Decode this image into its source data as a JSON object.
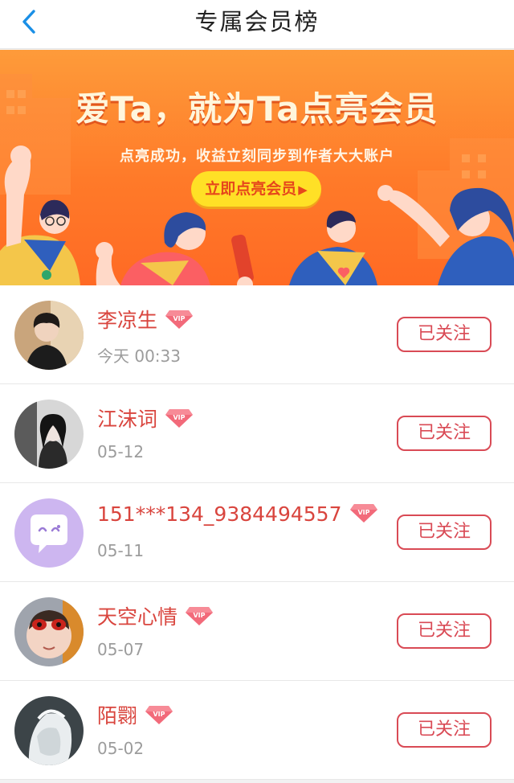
{
  "header": {
    "title": "专属会员榜",
    "back_icon": "chevron-left-icon"
  },
  "banner": {
    "headline": "爱Ta，就为Ta点亮会员",
    "subtitle": "点亮成功，收益立刻同步到作者大大账户",
    "button_label": "立即点亮会员",
    "button_icon": "triangle-right-icon",
    "colors": {
      "bg_top": "#fe9b3a",
      "bg_bottom": "#ff6a24",
      "button": "#ffe026"
    }
  },
  "members": [
    {
      "name": "李凉生",
      "date": "今天 00:33",
      "badge": "VIP",
      "follow_label": "已关注"
    },
    {
      "name": "江沫词",
      "date": "05-12",
      "badge": "VIP",
      "follow_label": "已关注"
    },
    {
      "name": "151***134_9384494557",
      "date": "05-11",
      "badge": "VIP",
      "follow_label": "已关注"
    },
    {
      "name": "天空心情",
      "date": "05-07",
      "badge": "VIP",
      "follow_label": "已关注"
    },
    {
      "name": "陌翾",
      "date": "05-02",
      "badge": "VIP",
      "follow_label": "已关注"
    }
  ],
  "colors": {
    "name": "#d9453e",
    "follow": "#d94a55",
    "date": "#9c9c9c"
  }
}
